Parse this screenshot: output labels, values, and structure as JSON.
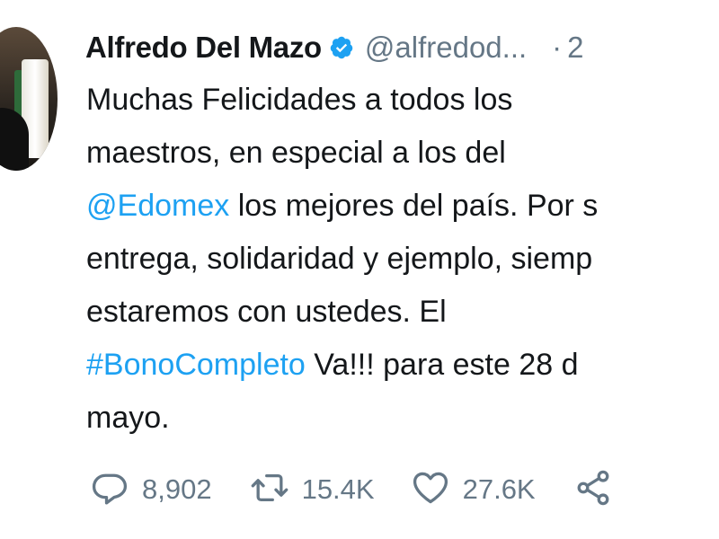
{
  "author": {
    "name": "Alfredo Del Mazo",
    "handle": "@alfredod...",
    "separator": "·",
    "time": "2"
  },
  "tweet": {
    "lines": [
      {
        "text": "Muchas Felicidades a todos los"
      },
      {
        "text": "maestros, en especial a los del"
      },
      {
        "mention": "@Edomex",
        "text": " los mejores del país. Por s"
      },
      {
        "text": "entrega, solidaridad y ejemplo, siemp"
      },
      {
        "text": "estaremos con ustedes. El"
      },
      {
        "hashtag": "#BonoCompleto",
        "text": " Va!!! para este 28 d"
      },
      {
        "text": "mayo."
      }
    ]
  },
  "actions": {
    "replies": "8,902",
    "retweets": "15.4K",
    "likes": "27.6K"
  },
  "colors": {
    "link": "#1da1f2",
    "muted": "#657786",
    "text": "#14171a",
    "verified": "#1da1f2"
  },
  "icons": {
    "verified": "verified-badge-icon",
    "reply": "reply-icon",
    "retweet": "retweet-icon",
    "like": "heart-icon",
    "share": "share-icon"
  }
}
